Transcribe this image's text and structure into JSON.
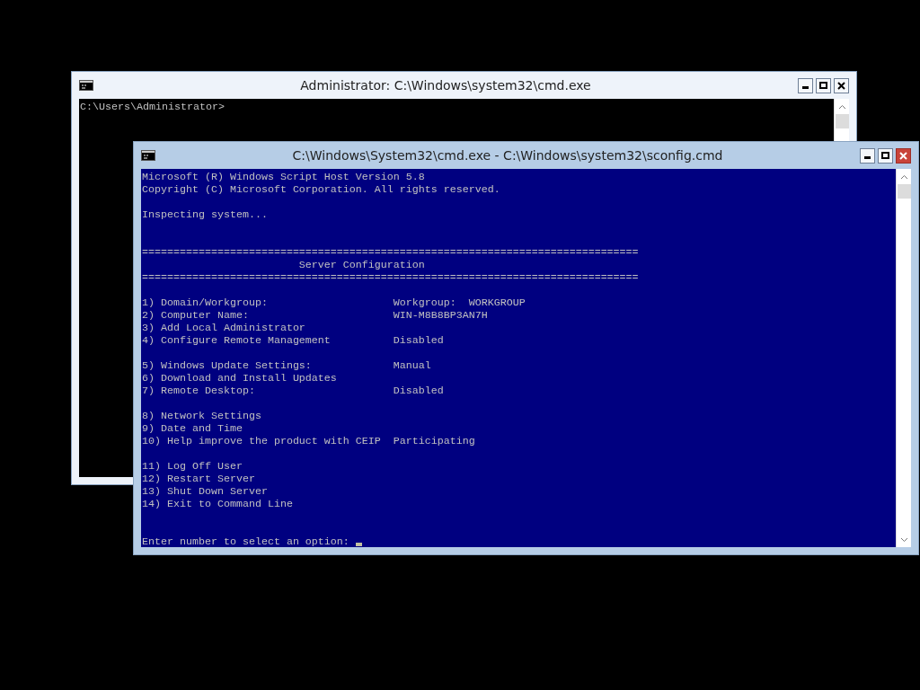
{
  "windows": [
    {
      "title": "Administrator: C:\\Windows\\system32\\cmd.exe",
      "active": false,
      "color": "#000000",
      "lines": [
        {
          "kind": "text",
          "text": "C:\\Users\\Administrator>"
        }
      ]
    },
    {
      "title": "C:\\Windows\\System32\\cmd.exe - C:\\Windows\\system32\\sconfig.cmd",
      "active": true,
      "color": "#000080",
      "lines": [
        {
          "kind": "text",
          "text": "Microsoft (R) Windows Script Host Version 5.8"
        },
        {
          "kind": "text",
          "text": "Copyright (C) Microsoft Corporation. All rights reserved."
        },
        {
          "kind": "blank"
        },
        {
          "kind": "text",
          "text": "Inspecting system..."
        },
        {
          "kind": "blank"
        },
        {
          "kind": "blank"
        },
        {
          "kind": "rule",
          "text": "==============================================================================="
        },
        {
          "kind": "heading",
          "text": "Server Configuration"
        },
        {
          "kind": "rule",
          "text": "==============================================================================="
        },
        {
          "kind": "blank"
        },
        {
          "kind": "option",
          "text": "1) Domain/Workgroup:",
          "value": "Workgroup:  WORKGROUP"
        },
        {
          "kind": "option",
          "text": "2) Computer Name:",
          "value": "WIN-M8B8BP3AN7H"
        },
        {
          "kind": "option",
          "text": "3) Add Local Administrator"
        },
        {
          "kind": "option",
          "text": "4) Configure Remote Management",
          "value": "Disabled"
        },
        {
          "kind": "blank"
        },
        {
          "kind": "option",
          "text": "5) Windows Update Settings:",
          "value": "Manual"
        },
        {
          "kind": "option",
          "text": "6) Download and Install Updates"
        },
        {
          "kind": "option",
          "text": "7) Remote Desktop:",
          "value": "Disabled"
        },
        {
          "kind": "blank"
        },
        {
          "kind": "option",
          "text": "8) Network Settings"
        },
        {
          "kind": "option",
          "text": "9) Date and Time"
        },
        {
          "kind": "option",
          "text": "10) Help improve the product with CEIP",
          "value": "Participating"
        },
        {
          "kind": "blank"
        },
        {
          "kind": "option",
          "text": "11) Log Off User"
        },
        {
          "kind": "option",
          "text": "12) Restart Server"
        },
        {
          "kind": "option",
          "text": "13) Shut Down Server"
        },
        {
          "kind": "option",
          "text": "14) Exit to Command Line"
        },
        {
          "kind": "blank"
        },
        {
          "kind": "blank"
        },
        {
          "kind": "prompt",
          "text": "Enter number to select an option:"
        }
      ]
    }
  ]
}
